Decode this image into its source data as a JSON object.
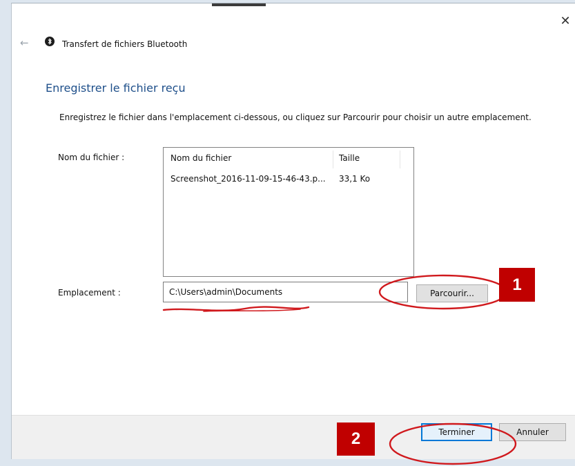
{
  "window": {
    "title": "Transfert de fichiers Bluetooth",
    "back_icon": "arrow-left-icon",
    "close_icon": "close-icon",
    "close_glyph": "✕",
    "back_glyph": "←"
  },
  "page": {
    "heading": "Enregistrer le fichier reçu",
    "instructions": "Enregistrez le fichier dans l'emplacement ci-dessous, ou cliquez sur Parcourir pour choisir un autre emplacement."
  },
  "file_section": {
    "label": "Nom du fichier :",
    "columns": [
      "Nom du fichier",
      "Taille"
    ],
    "rows": [
      {
        "name": "Screenshot_2016-11-09-15-46-43.p...",
        "size": "33,1 Ko"
      }
    ]
  },
  "location_section": {
    "label": "Emplacement :",
    "value": "C:\\Users\\admin\\Documents",
    "browse_label": "Parcourir..."
  },
  "footer": {
    "finish_label": "Terminer",
    "cancel_label": "Annuler"
  },
  "annotations": {
    "badge_1": "1",
    "badge_2": "2",
    "color": "#c00000"
  },
  "colors": {
    "heading": "#1e4f8a",
    "accent": "#0078d7"
  }
}
